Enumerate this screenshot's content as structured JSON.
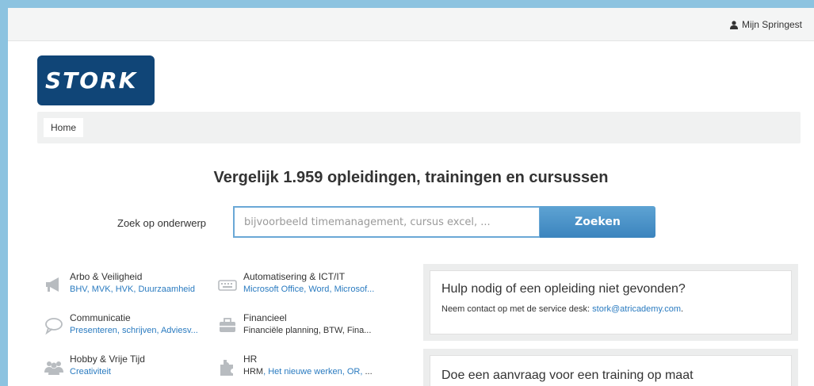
{
  "topbar": {
    "account_label": "Mijn Springest"
  },
  "logo": {
    "text": "STORK"
  },
  "breadcrumb": {
    "home": "Home"
  },
  "hero": {
    "title": "Vergelijk 1.959 opleidingen, trainingen en cursussen"
  },
  "search": {
    "label": "Zoek op onderwerp",
    "placeholder": "bijvoorbeeld timemanagement, cursus excel, ...",
    "button": "Zoeken"
  },
  "categories": [
    {
      "title": "Arbo & Veiligheid",
      "icon": "megaphone-icon",
      "links": [
        "BHV",
        "MVK",
        "HVK",
        "Duurzaamheid"
      ]
    },
    {
      "title": "Automatisering & ICT/IT",
      "icon": "keyboard-icon",
      "links": [
        "Microsoft Office",
        "Word",
        "Microsof..."
      ]
    },
    {
      "title": "Communicatie",
      "icon": "speech-bubble-icon",
      "links": [
        "Presenteren, schrijven",
        "Adviesv..."
      ]
    },
    {
      "title": "Financieel",
      "icon": "briefcase-icon",
      "plain": "Financiële planning, BTW, Fina..."
    },
    {
      "title": "Hobby & Vrije Tijd",
      "icon": "group-icon",
      "links": [
        "Creativiteit"
      ]
    },
    {
      "title": "HR",
      "icon": "puzzle-icon",
      "prefix": "HRM",
      "links": [
        "Het nieuwe werken",
        "OR"
      ],
      "suffix": "..."
    }
  ],
  "help_panel": {
    "title": "Hulp nodig of een opleiding niet gevonden?",
    "text_prefix": "Neem contact op met de service desk:",
    "email": "stork@atricademy.com",
    "text_suffix": "."
  },
  "request_panel": {
    "title": "Doe een aanvraag voor een training op maat"
  },
  "colors": {
    "accent": "#2a7bc0",
    "logo_bg": "#104577",
    "button": "#3b84be"
  }
}
